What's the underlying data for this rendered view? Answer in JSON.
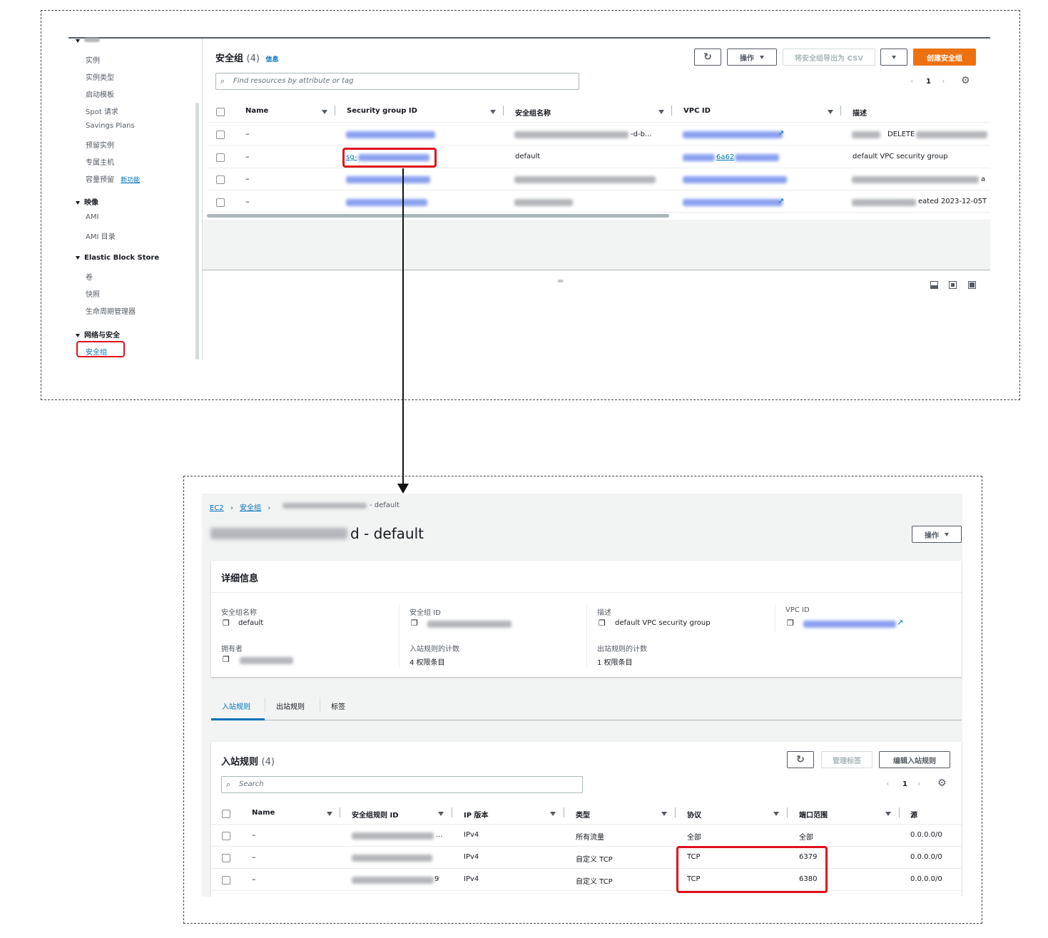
{
  "sidebar": {
    "items_instances": [
      "实例",
      "实例类型",
      "启动模板",
      "Spot 请求",
      "Savings Plans",
      "预留实例",
      "专属主机",
      "容量预留"
    ],
    "new_badge": "新功能",
    "images_header": "映像",
    "images_items": [
      "AMI",
      "AMI 目录"
    ],
    "ebs_header": "Elastic Block Store",
    "ebs_items": [
      "卷",
      "快照",
      "生命周期管理器"
    ],
    "network_header": "网络与安全",
    "active_item": "安全组"
  },
  "list_panel": {
    "title": "安全组",
    "count": "(4)",
    "info": "信息",
    "actions_label": "操作",
    "export_label": "将安全组导出为 CSV",
    "create_label": "创建安全组",
    "search_placeholder": "Find resources by attribute or tag",
    "page": "1",
    "columns": [
      "Name",
      "Security group ID",
      "安全组名称",
      "VPC ID",
      "描述"
    ],
    "rows": [
      {
        "name": "–",
        "sg_id_visible": "",
        "sg_name_visible": "-d-b...",
        "vpc_visible": "",
        "desc_visible": "DELETE"
      },
      {
        "name": "–",
        "sg_id_visible": "sg-",
        "sg_name_visible": "default",
        "vpc_visible": "6a62",
        "desc_visible": "default VPC security group"
      },
      {
        "name": "–",
        "sg_id_visible": "",
        "sg_name_visible": "",
        "vpc_visible": "",
        "desc_visible": "a"
      },
      {
        "name": "–",
        "sg_id_visible": "",
        "sg_name_visible": "",
        "vpc_visible": "",
        "desc_visible": "eated 2023-12-05T"
      }
    ],
    "splitter": "═"
  },
  "detail": {
    "breadcrumb": [
      "EC2",
      "安全组",
      "- default"
    ],
    "title_suffix": "d - default",
    "actions_label": "操作",
    "details_header": "详细信息",
    "fields": {
      "sg_name_label": "安全组名称",
      "sg_name_value": "default",
      "sg_id_label": "安全组 ID",
      "desc_label": "描述",
      "desc_value": "default VPC security group",
      "vpc_label": "VPC ID",
      "owner_label": "拥有者",
      "inbound_count_label": "入站规则的计数",
      "inbound_count_value": "4 权限条目",
      "outbound_count_label": "出站规则的计数",
      "outbound_count_value": "1 权限条目"
    },
    "tabs": [
      "入站规则",
      "出站规则",
      "标签"
    ],
    "inbound": {
      "title": "入站规则",
      "count": "(4)",
      "manage_tags": "管理标签",
      "edit_label": "编辑入站规则",
      "search_placeholder": "Search",
      "page": "1",
      "columns": [
        "Name",
        "安全组规则 ID",
        "IP 版本",
        "类型",
        "协议",
        "端口范围",
        "源"
      ],
      "rows": [
        {
          "name": "–",
          "rule_id_visible": "...",
          "ip": "IPv4",
          "type": "所有流量",
          "protocol": "全部",
          "port": "全部",
          "source": "0.0.0.0/0"
        },
        {
          "name": "–",
          "rule_id_visible": "",
          "ip": "IPv4",
          "type": "自定义 TCP",
          "protocol": "TCP",
          "port": "6379",
          "source": "0.0.0.0/0"
        },
        {
          "name": "–",
          "rule_id_visible": "9",
          "ip": "IPv4",
          "type": "自定义 TCP",
          "protocol": "TCP",
          "port": "6380",
          "source": "0.0.0.0/0"
        }
      ]
    }
  },
  "colors": {
    "accent_orange": "#ec7211",
    "link_blue": "#0073bb",
    "highlight_red": "#e0111d"
  }
}
